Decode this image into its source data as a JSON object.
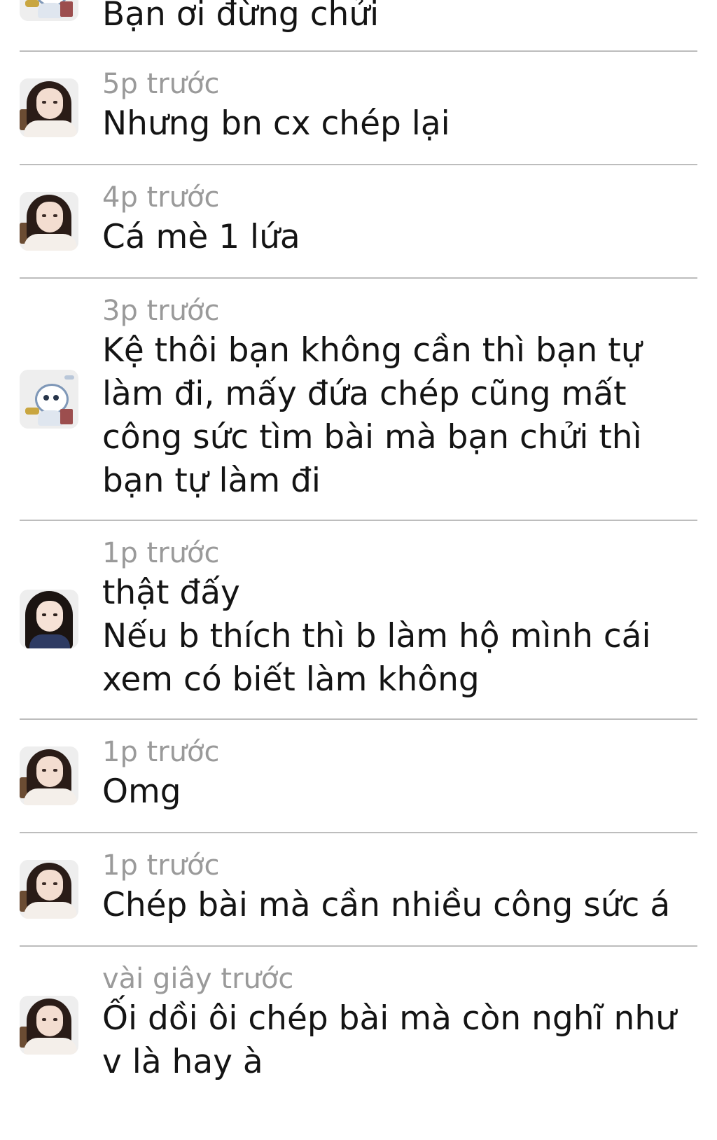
{
  "comments": [
    {
      "author_avatar": "cartoon-avatar",
      "time": "",
      "text": "Bạn ơi đừng chửi"
    },
    {
      "author_avatar": "girl-avatar",
      "time": "5p trước",
      "text": "Nhưng bn cx chép lại"
    },
    {
      "author_avatar": "girl-avatar",
      "time": "4p trước",
      "text": "Cá mè 1 lứa"
    },
    {
      "author_avatar": "cartoon-avatar",
      "time": "3p trước",
      "text": "Kệ thôi bạn không cần thì bạn tự\nlàm đi, mấy đứa chép cũng mất\ncông sức tìm bài mà bạn chửi thì\nbạn tự làm đi"
    },
    {
      "author_avatar": "girl-avatar-2",
      "time": "1p trước",
      "text": "thật đấy\nNếu b thích thì b làm hộ mình cái\nxem có biết làm không"
    },
    {
      "author_avatar": "girl-avatar",
      "time": "1p trước",
      "text": "Omg"
    },
    {
      "author_avatar": "girl-avatar",
      "time": "1p trước",
      "text": "Chép bài mà cần nhiều công sức á"
    },
    {
      "author_avatar": "girl-avatar",
      "time": "vài giây trước",
      "text": "Ối dồi ôi chép bài mà còn nghĩ như\nv là hay à"
    }
  ]
}
